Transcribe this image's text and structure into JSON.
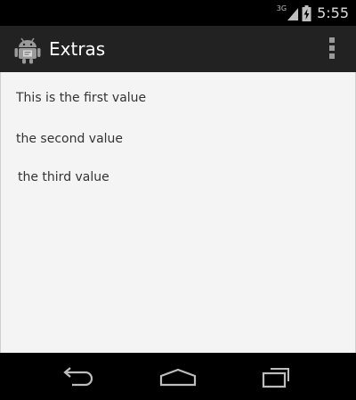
{
  "status_bar": {
    "network_type": "3G",
    "time": "5:55",
    "icons": [
      "signal-icon",
      "battery-charging-icon"
    ]
  },
  "action_bar": {
    "app_icon": "android-robot-icon",
    "title": "Extras",
    "overflow_icon": "overflow-menu-icon"
  },
  "content": {
    "values": [
      "This is the first value",
      "the second value",
      "the third value"
    ]
  },
  "nav_bar": {
    "buttons": [
      "back-icon",
      "home-icon",
      "recents-icon"
    ]
  },
  "colors": {
    "action_bar": "#222222",
    "content_background": "#f4f4f4",
    "text": "#333333",
    "status_bar": "#000000"
  }
}
